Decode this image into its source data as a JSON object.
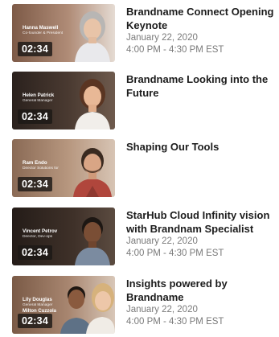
{
  "sessions": [
    {
      "title": "Brandname Connect Opening Keynote",
      "date": "January 22, 2020",
      "time": "4:00 PM - 4:30 PM EST",
      "duration": "02:34",
      "speaker_name": "Hanna Maswell",
      "speaker_role": "Co-founder & President"
    },
    {
      "title": "Brandname Looking into the Future",
      "duration": "02:34",
      "speaker_name": "Helen Patrick",
      "speaker_role": "General Manager"
    },
    {
      "title": "Shaping Our Tools",
      "duration": "02:34",
      "speaker_name": "Ram Endo",
      "speaker_role": "Director Solutions for"
    },
    {
      "title": "StarHub Cloud Infinity vision with Brandnam Specialist",
      "date": "January 22, 2020",
      "time": "4:00 PM - 4:30 PM EST",
      "duration": "02:34",
      "speaker_name": "Vincent Petrov",
      "speaker_role": "Director, Dev-ops"
    },
    {
      "title": "Insights powered by Brandname",
      "date": "January 22, 2020",
      "time": "4:00 PM - 4:30 PM EST",
      "duration": "02:34",
      "speaker_name": "Lily Douglas",
      "speaker_role": "General Manager",
      "speaker_name_2": "Milton Cuzzola"
    }
  ]
}
